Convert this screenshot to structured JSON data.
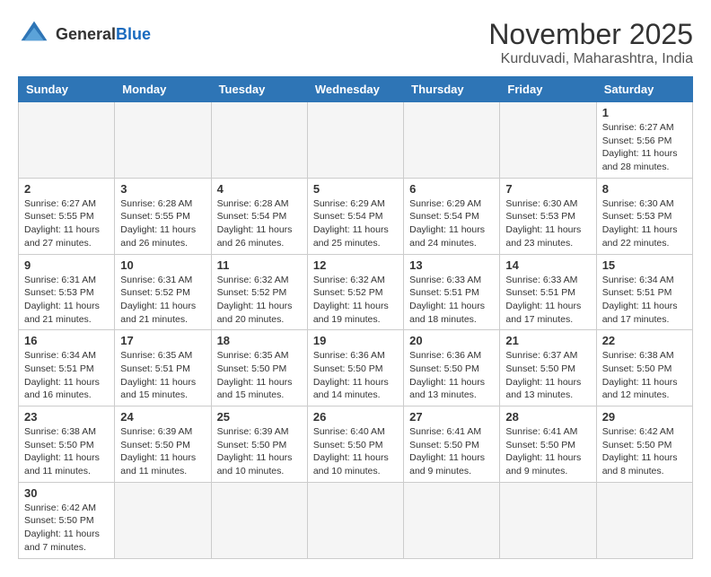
{
  "header": {
    "logo_general": "General",
    "logo_blue": "Blue",
    "month": "November 2025",
    "location": "Kurduvadi, Maharashtra, India"
  },
  "weekdays": [
    "Sunday",
    "Monday",
    "Tuesday",
    "Wednesday",
    "Thursday",
    "Friday",
    "Saturday"
  ],
  "weeks": [
    [
      {
        "day": "",
        "info": ""
      },
      {
        "day": "",
        "info": ""
      },
      {
        "day": "",
        "info": ""
      },
      {
        "day": "",
        "info": ""
      },
      {
        "day": "",
        "info": ""
      },
      {
        "day": "",
        "info": ""
      },
      {
        "day": "1",
        "info": "Sunrise: 6:27 AM\nSunset: 5:56 PM\nDaylight: 11 hours\nand 28 minutes."
      }
    ],
    [
      {
        "day": "2",
        "info": "Sunrise: 6:27 AM\nSunset: 5:55 PM\nDaylight: 11 hours\nand 27 minutes."
      },
      {
        "day": "3",
        "info": "Sunrise: 6:28 AM\nSunset: 5:55 PM\nDaylight: 11 hours\nand 26 minutes."
      },
      {
        "day": "4",
        "info": "Sunrise: 6:28 AM\nSunset: 5:54 PM\nDaylight: 11 hours\nand 26 minutes."
      },
      {
        "day": "5",
        "info": "Sunrise: 6:29 AM\nSunset: 5:54 PM\nDaylight: 11 hours\nand 25 minutes."
      },
      {
        "day": "6",
        "info": "Sunrise: 6:29 AM\nSunset: 5:54 PM\nDaylight: 11 hours\nand 24 minutes."
      },
      {
        "day": "7",
        "info": "Sunrise: 6:30 AM\nSunset: 5:53 PM\nDaylight: 11 hours\nand 23 minutes."
      },
      {
        "day": "8",
        "info": "Sunrise: 6:30 AM\nSunset: 5:53 PM\nDaylight: 11 hours\nand 22 minutes."
      }
    ],
    [
      {
        "day": "9",
        "info": "Sunrise: 6:31 AM\nSunset: 5:53 PM\nDaylight: 11 hours\nand 21 minutes."
      },
      {
        "day": "10",
        "info": "Sunrise: 6:31 AM\nSunset: 5:52 PM\nDaylight: 11 hours\nand 21 minutes."
      },
      {
        "day": "11",
        "info": "Sunrise: 6:32 AM\nSunset: 5:52 PM\nDaylight: 11 hours\nand 20 minutes."
      },
      {
        "day": "12",
        "info": "Sunrise: 6:32 AM\nSunset: 5:52 PM\nDaylight: 11 hours\nand 19 minutes."
      },
      {
        "day": "13",
        "info": "Sunrise: 6:33 AM\nSunset: 5:51 PM\nDaylight: 11 hours\nand 18 minutes."
      },
      {
        "day": "14",
        "info": "Sunrise: 6:33 AM\nSunset: 5:51 PM\nDaylight: 11 hours\nand 17 minutes."
      },
      {
        "day": "15",
        "info": "Sunrise: 6:34 AM\nSunset: 5:51 PM\nDaylight: 11 hours\nand 17 minutes."
      }
    ],
    [
      {
        "day": "16",
        "info": "Sunrise: 6:34 AM\nSunset: 5:51 PM\nDaylight: 11 hours\nand 16 minutes."
      },
      {
        "day": "17",
        "info": "Sunrise: 6:35 AM\nSunset: 5:51 PM\nDaylight: 11 hours\nand 15 minutes."
      },
      {
        "day": "18",
        "info": "Sunrise: 6:35 AM\nSunset: 5:50 PM\nDaylight: 11 hours\nand 15 minutes."
      },
      {
        "day": "19",
        "info": "Sunrise: 6:36 AM\nSunset: 5:50 PM\nDaylight: 11 hours\nand 14 minutes."
      },
      {
        "day": "20",
        "info": "Sunrise: 6:36 AM\nSunset: 5:50 PM\nDaylight: 11 hours\nand 13 minutes."
      },
      {
        "day": "21",
        "info": "Sunrise: 6:37 AM\nSunset: 5:50 PM\nDaylight: 11 hours\nand 13 minutes."
      },
      {
        "day": "22",
        "info": "Sunrise: 6:38 AM\nSunset: 5:50 PM\nDaylight: 11 hours\nand 12 minutes."
      }
    ],
    [
      {
        "day": "23",
        "info": "Sunrise: 6:38 AM\nSunset: 5:50 PM\nDaylight: 11 hours\nand 11 minutes."
      },
      {
        "day": "24",
        "info": "Sunrise: 6:39 AM\nSunset: 5:50 PM\nDaylight: 11 hours\nand 11 minutes."
      },
      {
        "day": "25",
        "info": "Sunrise: 6:39 AM\nSunset: 5:50 PM\nDaylight: 11 hours\nand 10 minutes."
      },
      {
        "day": "26",
        "info": "Sunrise: 6:40 AM\nSunset: 5:50 PM\nDaylight: 11 hours\nand 10 minutes."
      },
      {
        "day": "27",
        "info": "Sunrise: 6:41 AM\nSunset: 5:50 PM\nDaylight: 11 hours\nand 9 minutes."
      },
      {
        "day": "28",
        "info": "Sunrise: 6:41 AM\nSunset: 5:50 PM\nDaylight: 11 hours\nand 9 minutes."
      },
      {
        "day": "29",
        "info": "Sunrise: 6:42 AM\nSunset: 5:50 PM\nDaylight: 11 hours\nand 8 minutes."
      }
    ],
    [
      {
        "day": "30",
        "info": "Sunrise: 6:42 AM\nSunset: 5:50 PM\nDaylight: 11 hours\nand 7 minutes."
      },
      {
        "day": "",
        "info": ""
      },
      {
        "day": "",
        "info": ""
      },
      {
        "day": "",
        "info": ""
      },
      {
        "day": "",
        "info": ""
      },
      {
        "day": "",
        "info": ""
      },
      {
        "day": "",
        "info": ""
      }
    ]
  ]
}
